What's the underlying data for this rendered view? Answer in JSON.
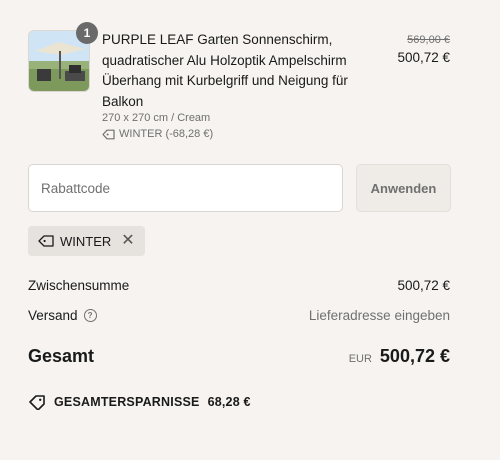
{
  "product": {
    "quantity": "1",
    "title": "PURPLE LEAF Garten Sonnenschirm, quadratischer Alu Holzoptik Ampelschirm Überhang mit Kurbelgriff und Neigung für Balkon",
    "variant": "270 x 270 cm / Cream",
    "discount": "WINTER (-68,28 €)",
    "original_price": "569,00 €",
    "price": "500,72 €",
    "image_icon": "garden-umbrella-image"
  },
  "discount_code": {
    "placeholder": "Rabattcode",
    "value": "",
    "apply_label": "Anwenden",
    "applied_code": "WINTER"
  },
  "summary": {
    "subtotal_label": "Zwischensumme",
    "subtotal_value": "500,72 €",
    "shipping_label": "Versand",
    "shipping_value": "Lieferadresse eingeben",
    "total_label": "Gesamt",
    "currency": "EUR",
    "total_value": "500,72 €",
    "savings_label": "GESAMTERSPARNISSE",
    "savings_value": "68,28 €"
  }
}
